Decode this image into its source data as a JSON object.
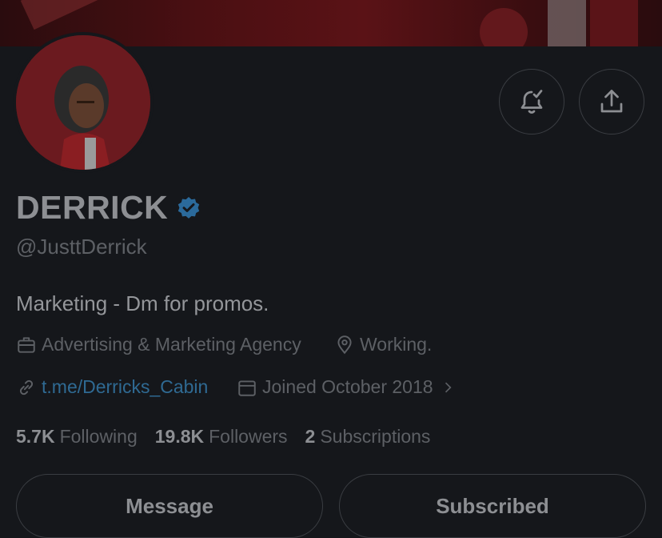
{
  "profile": {
    "name": "DERRICK",
    "handle": "@JusttDerrick",
    "bio": "Marketing - Dm for promos.",
    "category": "Advertising & Marketing Agency",
    "location": "Working.",
    "link": "t.me/Derricks_Cabin",
    "joined": "Joined October 2018"
  },
  "stats": {
    "following_count": "5.7K",
    "following_label": "Following",
    "followers_count": "19.8K",
    "followers_label": "Followers",
    "subscriptions_count": "2",
    "subscriptions_label": "Subscriptions"
  },
  "actions": {
    "message_label": "Message",
    "subscribed_label": "Subscribed"
  },
  "icons": {
    "notify": "bell-check-icon",
    "share": "share-icon",
    "verified": "verified-badge-icon"
  },
  "colors": {
    "background": "#15171b",
    "verified": "#2b6a9b",
    "link": "#2f6a93"
  }
}
